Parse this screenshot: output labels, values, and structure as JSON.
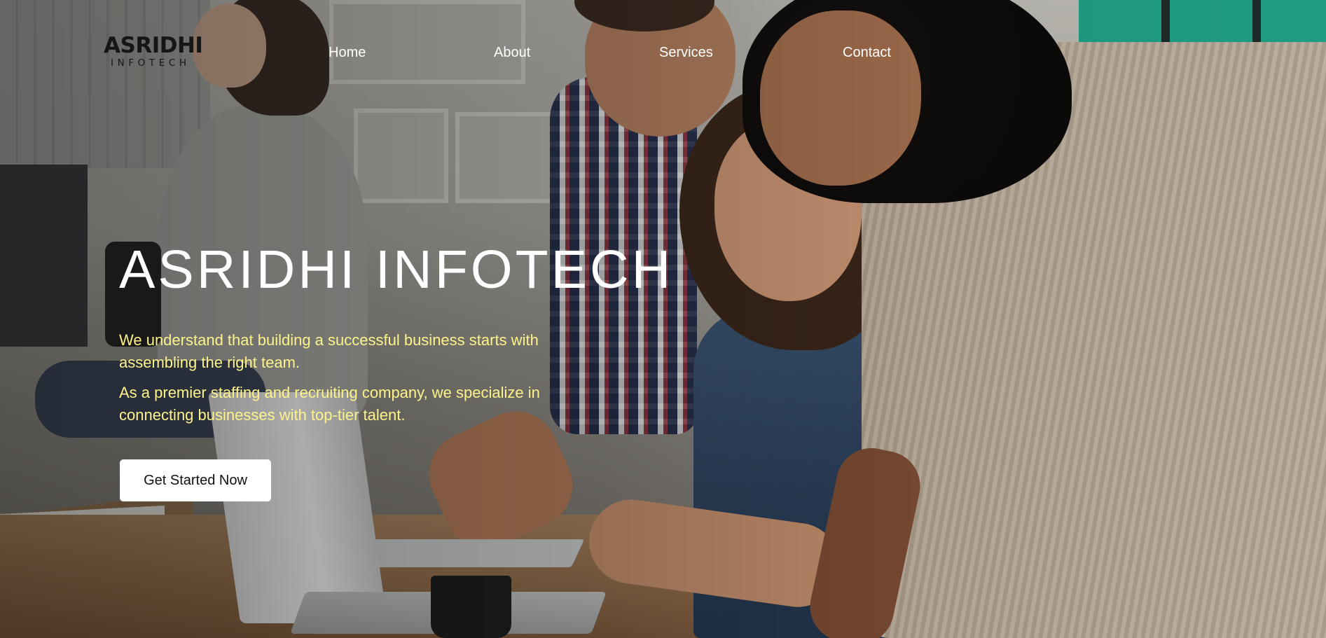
{
  "logo": {
    "main": "ASRIDHI",
    "sub": "INFOTECH"
  },
  "nav": {
    "items": [
      {
        "label": "Home"
      },
      {
        "label": "About"
      },
      {
        "label": "Services"
      },
      {
        "label": "Contact"
      }
    ]
  },
  "hero": {
    "title": "ASRIDHI INFOTECH",
    "paragraphs": [
      "We understand that building a successful business starts with assembling the right team.",
      "As a premier staffing and recruiting company, we specialize in connecting businesses with top-tier talent."
    ],
    "cta_label": "Get Started Now",
    "text_color": "#fdf38a"
  },
  "background": {
    "description_colors": {
      "overlay": "#000000",
      "accent_teal": "#1f9c83"
    }
  }
}
